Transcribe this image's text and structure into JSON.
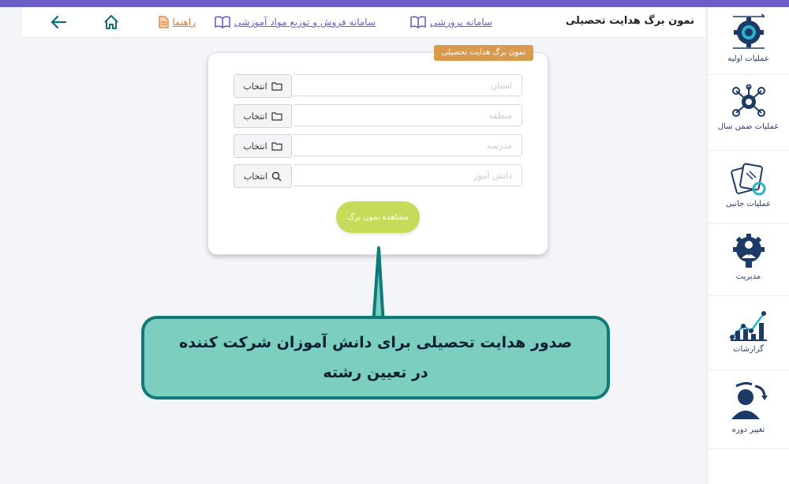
{
  "header": {
    "title": "نمون برگ هدایت تحصیلی",
    "link_parvareshi": "سامانه پرورشی",
    "link_sales": "سامانه فروش و توزیع مواد آموزشی",
    "link_help": "راهنما",
    "icons": {
      "home": "home-icon",
      "back": "arrow-left-icon",
      "book": "book-icon",
      "doc": "document-icon"
    }
  },
  "sidebar": {
    "items": [
      {
        "label": "عملیات اولیه",
        "icon": "gear-icon"
      },
      {
        "label": "عملیات ضمن سال",
        "icon": "network-gear-icon"
      },
      {
        "label": "عملیات جانبی",
        "icon": "wrench-cards-icon"
      },
      {
        "label": "مدیریت",
        "icon": "manager-gear-icon"
      },
      {
        "label": "گزارشات",
        "icon": "chart-icon"
      },
      {
        "label": "تغییر دوره",
        "icon": "user-refresh-icon"
      }
    ]
  },
  "form": {
    "tag": "نمون برگ هدایت تحصیلی",
    "fields": [
      {
        "placeholder": "استان",
        "button": "انتخاب",
        "icon": "folder-icon"
      },
      {
        "placeholder": "منطقه",
        "button": "انتخاب",
        "icon": "folder-icon"
      },
      {
        "placeholder": "مدرسه",
        "button": "انتخاب",
        "icon": "folder-icon"
      },
      {
        "placeholder": "دانش آموز",
        "button": "انتخاب",
        "icon": "search-icon"
      }
    ],
    "submit": "مشاهده نمون برگ"
  },
  "callout": {
    "line1": "صدور هدایت تحصیلی برای دانش آموزان شرکت کننده",
    "line2": "در تعیین رشته"
  },
  "colors": {
    "accent": "#6b5fc7",
    "navy": "#2d3e66",
    "tag": "#d99a4d",
    "submit": "#c5dc5a",
    "callout_fill": "#7ccfbf",
    "callout_border": "#0f7a78"
  }
}
